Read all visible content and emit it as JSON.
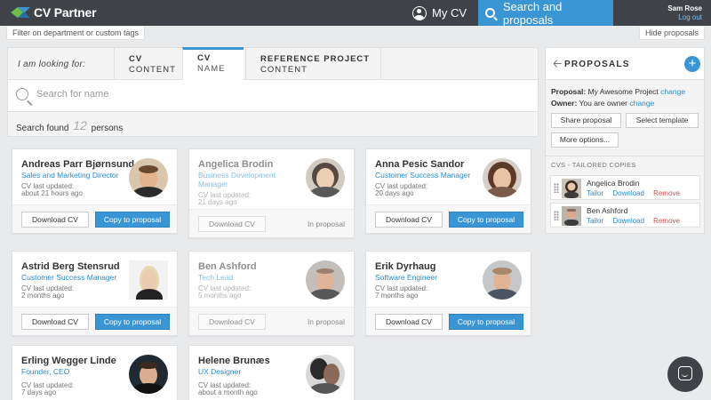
{
  "app": {
    "logo_text": "CV Partner"
  },
  "nav": {
    "my_cv": "My CV",
    "search_proposals": "Search and proposals"
  },
  "user": {
    "name": "Sam Rose",
    "logout": "Log out"
  },
  "filters": {
    "filter_label": "Filter on department or custom tags",
    "hide_proposals": "Hide proposals"
  },
  "search": {
    "looking_for": "I am looking for:",
    "tabs": [
      {
        "line1": "CV",
        "line2": "CONTENT"
      },
      {
        "line1": "CV",
        "line2": "NAME"
      },
      {
        "line1": "REFERENCE PROJECT",
        "line2": "CONTENT"
      }
    ],
    "placeholder": "Search for name",
    "results_prefix": "Search found",
    "results_count": "12",
    "results_suffix": "persons"
  },
  "cards": [
    {
      "name": "Andreas Parr Bjørnsund",
      "role": "Sales and Marketing Director",
      "updated_label": "CV last updated:",
      "updated": "about 21 hours ago",
      "download": "Download CV",
      "action": "Copy to proposal"
    },
    {
      "name": "Angelica Brodin",
      "role": "Business Development Manager",
      "updated_label": "CV last updated:",
      "updated": "21 days ago",
      "download": "Download CV",
      "action": "In proposal"
    },
    {
      "name": "Anna Pesic Sandor",
      "role": "Customer Success Manager",
      "updated_label": "CV last updated:",
      "updated": "20 days ago",
      "download": "Download CV",
      "action": "Copy to proposal"
    },
    {
      "name": "Astrid Berg Stensrud",
      "role": "Customer Success Manager",
      "updated_label": "CV last updated:",
      "updated": "2 months ago",
      "download": "Download CV",
      "action": "Copy to proposal"
    },
    {
      "name": "Ben Ashford",
      "role": "Tech Lead",
      "updated_label": "CV last updated:",
      "updated": "5 months ago",
      "download": "Download CV",
      "action": "In proposal"
    },
    {
      "name": "Erik Dyrhaug",
      "role": "Software Engineer",
      "updated_label": "CV last updated:",
      "updated": "7 months ago",
      "download": "Download CV",
      "action": "Copy to proposal"
    },
    {
      "name": "Erling Wegger Linde",
      "role": "Founder, CEO",
      "updated_label": "CV last updated:",
      "updated": "7 days ago"
    },
    {
      "name": "Helene Brunæs",
      "role": "UX Designer",
      "updated_label": "CV last updated:",
      "updated": "about a month ago"
    }
  ],
  "proposals": {
    "title": "PROPOSALS",
    "add": "+",
    "proposal_label": "Proposal:",
    "proposal_name": "My Awesome Project",
    "change": "change",
    "owner_label": "Owner:",
    "owner_value": "You are owner",
    "share": "Share proposal",
    "select_template": "Select template",
    "more_options": "More options...",
    "cvs_header": "CVS - TAILORED COPIES",
    "copies": [
      {
        "name": "Angelica Brodin",
        "tailor": "Tailor",
        "download": "Download",
        "remove": "Remove"
      },
      {
        "name": "Ben Ashford",
        "tailor": "Tailor",
        "download": "Download",
        "remove": "Remove"
      }
    ]
  },
  "colors": {
    "accent": "#3a95d4",
    "topbar": "#3f4348",
    "remove": "#d9534f"
  },
  "icons": {
    "user": "user-circle-icon",
    "search": "search-icon",
    "back": "arrow-left-icon",
    "add": "plus-icon",
    "chat": "chat-icon",
    "drag": "drag-handle-icon"
  }
}
